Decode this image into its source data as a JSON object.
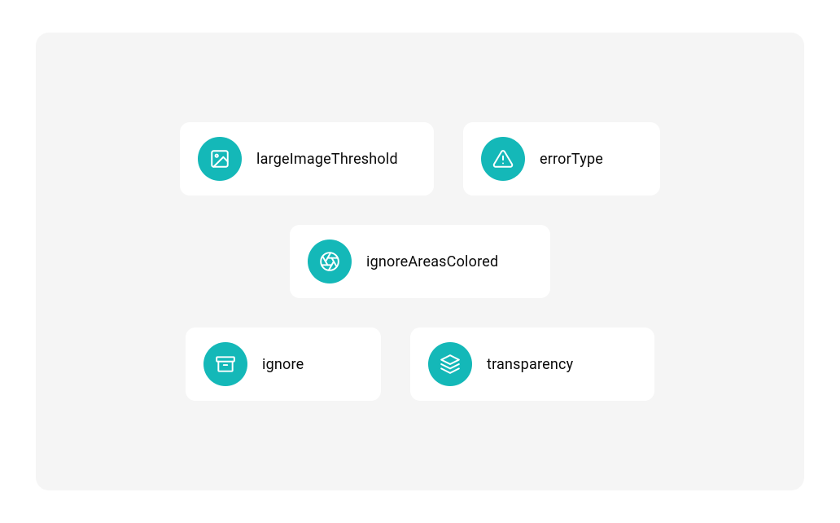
{
  "accent_color": "#14b8b8",
  "cards": {
    "large_image_threshold": {
      "label": "largeImageThreshold",
      "icon": "image-icon"
    },
    "error_type": {
      "label": "errorType",
      "icon": "warning-triangle-icon"
    },
    "ignore_areas_colored": {
      "label": "ignoreAreasColored",
      "icon": "aperture-icon"
    },
    "ignore": {
      "label": "ignore",
      "icon": "archive-icon"
    },
    "transparency": {
      "label": "transparency",
      "icon": "layers-icon"
    }
  }
}
